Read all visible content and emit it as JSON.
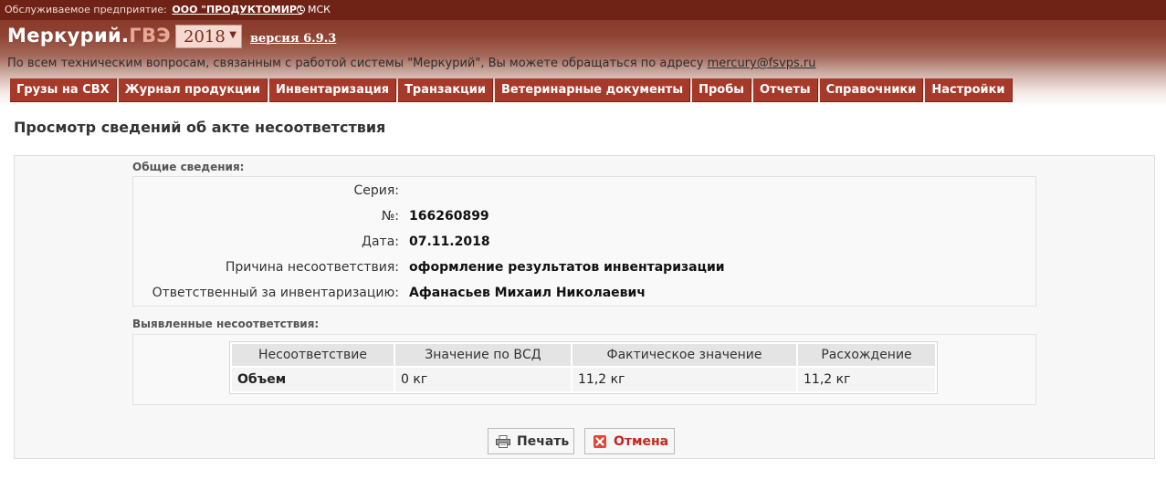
{
  "topbar": {
    "enterprise_label": "Обслуживаемое предприятие:",
    "enterprise_name": "ООО \"ПРОДУКТОМИР\"",
    "timezone": "МСК"
  },
  "header": {
    "brand_main": "Меркурий.",
    "brand_sub": "ГВЭ",
    "year": "2018",
    "version": "версия 6.9.3",
    "support_text": "По всем техническим вопросам, связанным с работой системы \"Меркурий\", Вы можете обращаться по адресу ",
    "support_email": "mercury@fsvps.ru"
  },
  "menu": [
    {
      "label": "Грузы на СВХ"
    },
    {
      "label": "Журнал продукции"
    },
    {
      "label": "Инвентаризация"
    },
    {
      "label": "Транзакции"
    },
    {
      "label": "Ветеринарные документы"
    },
    {
      "label": "Пробы"
    },
    {
      "label": "Отчеты"
    },
    {
      "label": "Справочники"
    },
    {
      "label": "Настройки"
    }
  ],
  "page": {
    "title": "Просмотр сведений об акте несоответствия"
  },
  "general": {
    "section_title": "Общие сведения:",
    "fields": [
      {
        "label": "Серия:",
        "value": ""
      },
      {
        "label": "№:",
        "value": "166260899"
      },
      {
        "label": "Дата:",
        "value": "07.11.2018"
      },
      {
        "label": "Причина несоответствия:",
        "value": "оформление результатов инвентаризации"
      },
      {
        "label": "Ответственный за инвентаризацию:",
        "value": "Афанасьев Михаил Николаевич"
      }
    ]
  },
  "discrepancies": {
    "section_title": "Выявленные несоответствия:",
    "columns": [
      "Несоответствие",
      "Значение по ВСД",
      "Фактическое значение",
      "Расхождение"
    ],
    "rows": [
      [
        "Объем",
        "0 кг",
        "11,2 кг",
        "11,2 кг"
      ]
    ]
  },
  "actions": {
    "print_label": "Печать",
    "cancel_label": "Отмена"
  },
  "icons": {
    "print": "printer-icon",
    "cancel": "close-icon",
    "clock": "clock-icon",
    "dropdown": "chevron-down-icon"
  },
  "colors": {
    "brand": "#7c2a1c",
    "menu": "#a63a2a",
    "cancel_text": "#c8261a"
  }
}
